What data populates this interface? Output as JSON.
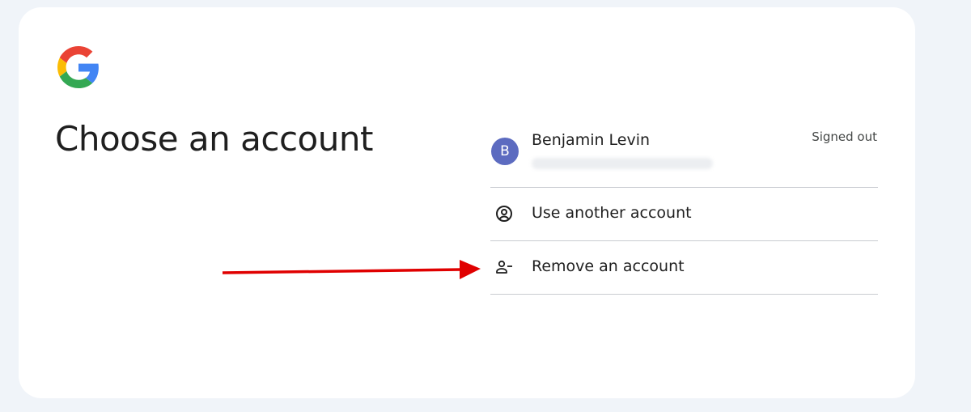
{
  "heading": "Choose an account",
  "accounts": [
    {
      "initial": "B",
      "name": "Benjamin Levin",
      "email": "••••••••••••••••••••••••",
      "status": "Signed out",
      "avatar_color": "#5c6bc0"
    }
  ],
  "actions": {
    "use_another": "Use another account",
    "remove": "Remove an account"
  },
  "icons": {
    "logo": "google-g-logo",
    "use_another": "account-circle-icon",
    "remove": "person-remove-icon",
    "annotation": "red-arrow"
  },
  "colors": {
    "page_background": "#f0f4f9",
    "card_background": "#ffffff",
    "text_primary": "#1f1f1f",
    "text_secondary": "#444746",
    "divider": "#c9ccd1",
    "arrow": "#e00000",
    "google_blue": "#4285f4",
    "google_red": "#ea4335",
    "google_yellow": "#fbbc05",
    "google_green": "#34a853"
  }
}
